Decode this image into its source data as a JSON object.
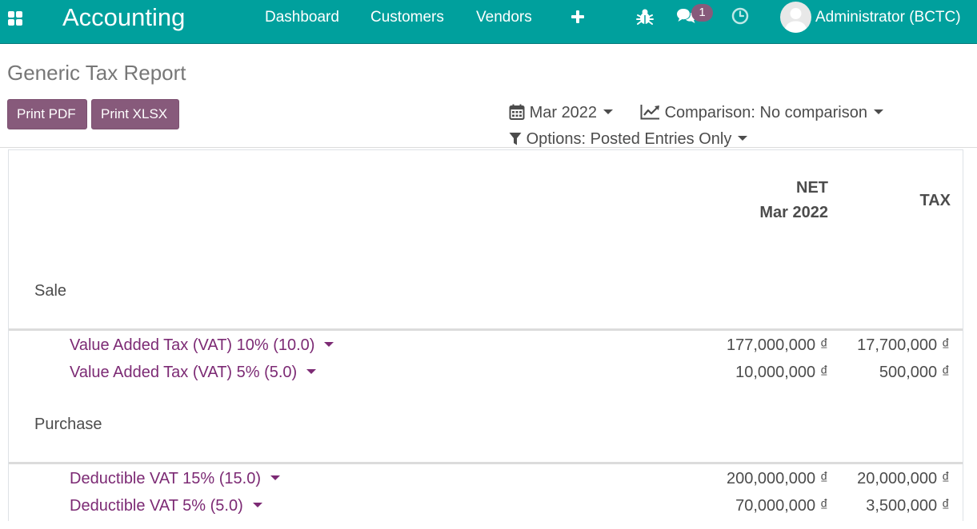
{
  "navbar": {
    "app_name": "Accounting",
    "links": [
      "Dashboard",
      "Customers",
      "Vendors"
    ],
    "message_count": "1",
    "user_name": "Administrator (BCTC)",
    "icons": [
      "apps-menu-icon",
      "plus-icon",
      "bug-icon",
      "chat-icon",
      "clock-icon",
      "avatar"
    ],
    "colors": {
      "bar": "#00a09d",
      "badge": "#875a7b"
    }
  },
  "control_panel": {
    "title": "Generic Tax Report",
    "buttons": {
      "print_pdf": "Print PDF",
      "print_xlsx": "Print XLSX"
    },
    "filters": {
      "date": "Mar 2022",
      "comparison": "Comparison: No comparison",
      "options": "Options: Posted Entries Only"
    },
    "button_color": "#875a7b"
  },
  "report": {
    "columns": {
      "net_title": "NET",
      "net_period": "Mar 2022",
      "tax_title": "TAX"
    },
    "sections": [
      {
        "name": "Sale",
        "lines": [
          {
            "name": "Value Added Tax (VAT) 10% (10.0)",
            "net": "177,000,000 ₫",
            "tax": "17,700,000 ₫"
          },
          {
            "name": "Value Added Tax (VAT) 5% (5.0)",
            "net": "10,000,000 ₫",
            "tax": "500,000 ₫"
          }
        ]
      },
      {
        "name": "Purchase",
        "lines": [
          {
            "name": "Deductible VAT 15% (15.0)",
            "net": "200,000,000 ₫",
            "tax": "20,000,000 ₫"
          },
          {
            "name": "Deductible VAT 5% (5.0)",
            "net": "70,000,000 ₫",
            "tax": "3,500,000 ₫"
          }
        ]
      }
    ],
    "link_color": "#7c2a74"
  }
}
